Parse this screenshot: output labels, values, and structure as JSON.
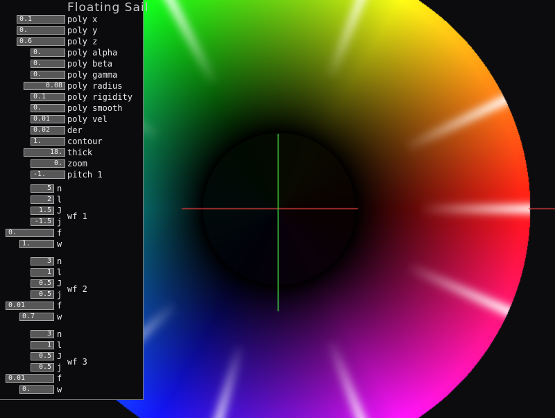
{
  "app": {
    "title": "Floating Sail"
  },
  "params": [
    {
      "value": "0.1",
      "label": "poly x"
    },
    {
      "value": "0.",
      "label": "poly y"
    },
    {
      "value": "0.6",
      "label": "poly z"
    },
    {
      "value": "0.",
      "label": "poly alpha"
    },
    {
      "value": "0.",
      "label": "poly beta"
    },
    {
      "value": "0.",
      "label": "poly gamma"
    },
    {
      "value": "0.08",
      "label": "poly radius"
    },
    {
      "value": "0.1",
      "label": "poly rigidity"
    },
    {
      "value": "0.",
      "label": "poly smooth"
    },
    {
      "value": "0.01",
      "label": "poly vel"
    },
    {
      "value": "0.02",
      "label": "der"
    },
    {
      "value": "1.",
      "label": "contour"
    },
    {
      "value": "18.",
      "label": "thick"
    },
    {
      "value": "0.",
      "label": "zoom"
    },
    {
      "value": "-1.",
      "label": "pitch 1"
    }
  ],
  "groups": [
    {
      "name": "wf 1",
      "fields": [
        {
          "value": "5",
          "label": "n"
        },
        {
          "value": "2",
          "label": "l"
        },
        {
          "value": "1.5",
          "label": "J"
        },
        {
          "value": "-1.5",
          "label": "j"
        },
        {
          "value": "0.",
          "label": "f"
        },
        {
          "value": "1.",
          "label": "w"
        }
      ]
    },
    {
      "name": "wf 2",
      "fields": [
        {
          "value": "3",
          "label": "n"
        },
        {
          "value": "1",
          "label": "l"
        },
        {
          "value": "0.5",
          "label": "J"
        },
        {
          "value": "0.5",
          "label": "j"
        },
        {
          "value": "0.01",
          "label": "f"
        },
        {
          "value": "0.7",
          "label": "w"
        }
      ]
    },
    {
      "name": "wf 3",
      "fields": [
        {
          "value": "3",
          "label": "n"
        },
        {
          "value": "1",
          "label": "l"
        },
        {
          "value": "0.5",
          "label": "J"
        },
        {
          "value": "0.5",
          "label": "j"
        },
        {
          "value": "0.01",
          "label": "f"
        },
        {
          "value": "0.",
          "label": "w"
        }
      ]
    }
  ],
  "colors": {
    "background": "#0c0c0f",
    "field_bg": "#575757",
    "crosshair_h": "#d23a3a",
    "crosshair_v": "#3ecf3e"
  }
}
